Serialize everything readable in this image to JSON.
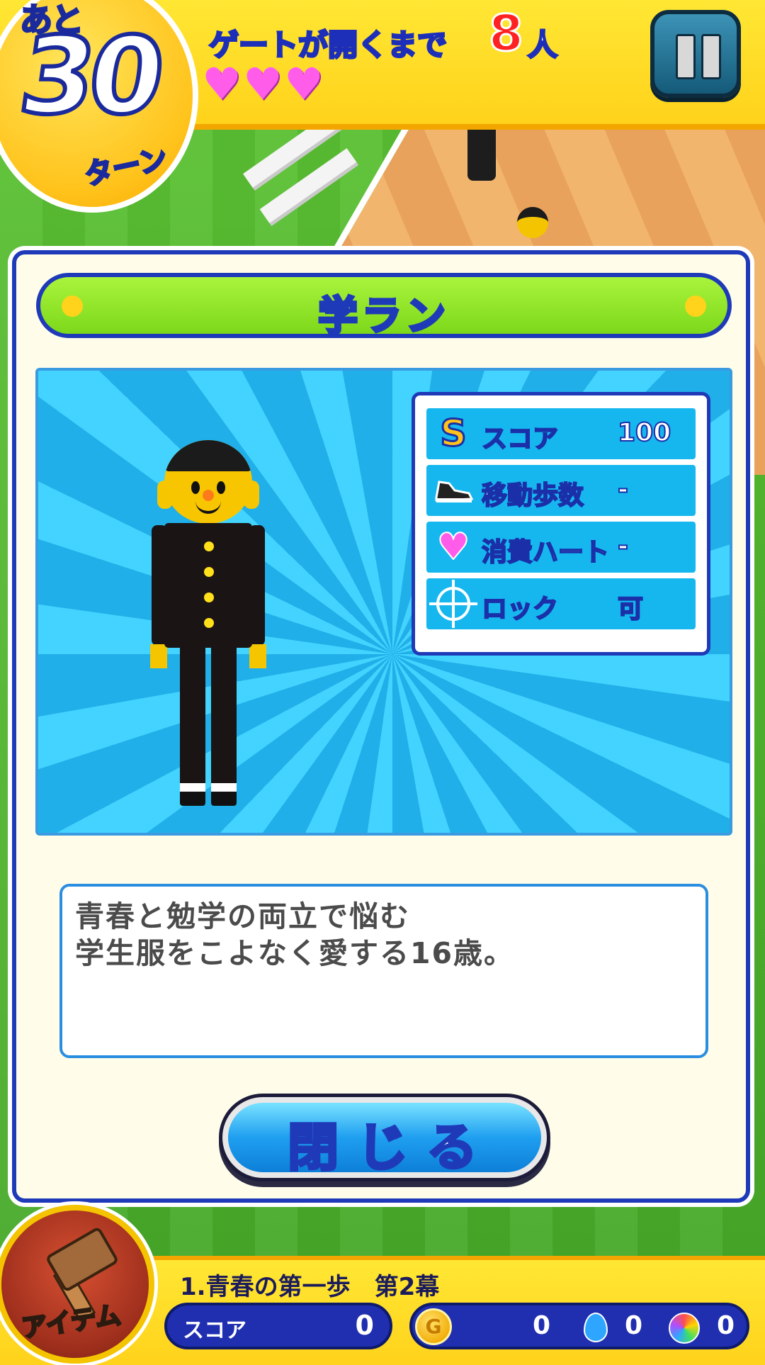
{
  "hud": {
    "turns_prefix": "あと",
    "turns_value": "30",
    "turns_unit": "ターン",
    "gate_text": "ゲートが開くまで",
    "gate_count": "8",
    "gate_unit": "人",
    "hearts": 3
  },
  "panel": {
    "title": "学ラン",
    "stats": [
      {
        "icon": "score-s-icon",
        "label": "スコア",
        "value": "100"
      },
      {
        "icon": "sneaker-icon",
        "label": "移動歩数",
        "value": "-"
      },
      {
        "icon": "heart-icon",
        "label": "消費ハート",
        "value": "-"
      },
      {
        "icon": "crosshair-icon",
        "label": "ロック",
        "value": "可"
      }
    ],
    "description": [
      "青春と勉学の両立で悩む",
      "学生服をこよなく愛する16歳。"
    ],
    "close_label": "閉じる"
  },
  "bottom": {
    "item_label": "アイテム",
    "stage_title": "1.青春の第一歩　第2幕",
    "score_label": "スコア",
    "score_value": "0",
    "coin_letter": "G",
    "coins": "0",
    "drops": "0",
    "gems": "0"
  },
  "colors": {
    "hud_yellow": "#ffd21b",
    "panel_border": "#1f3ab8",
    "title_green": "#7dd81a",
    "sky_blue": "#16b7ef",
    "heart_pink": "#ff5ce9",
    "gate_red": "#ff2222"
  }
}
